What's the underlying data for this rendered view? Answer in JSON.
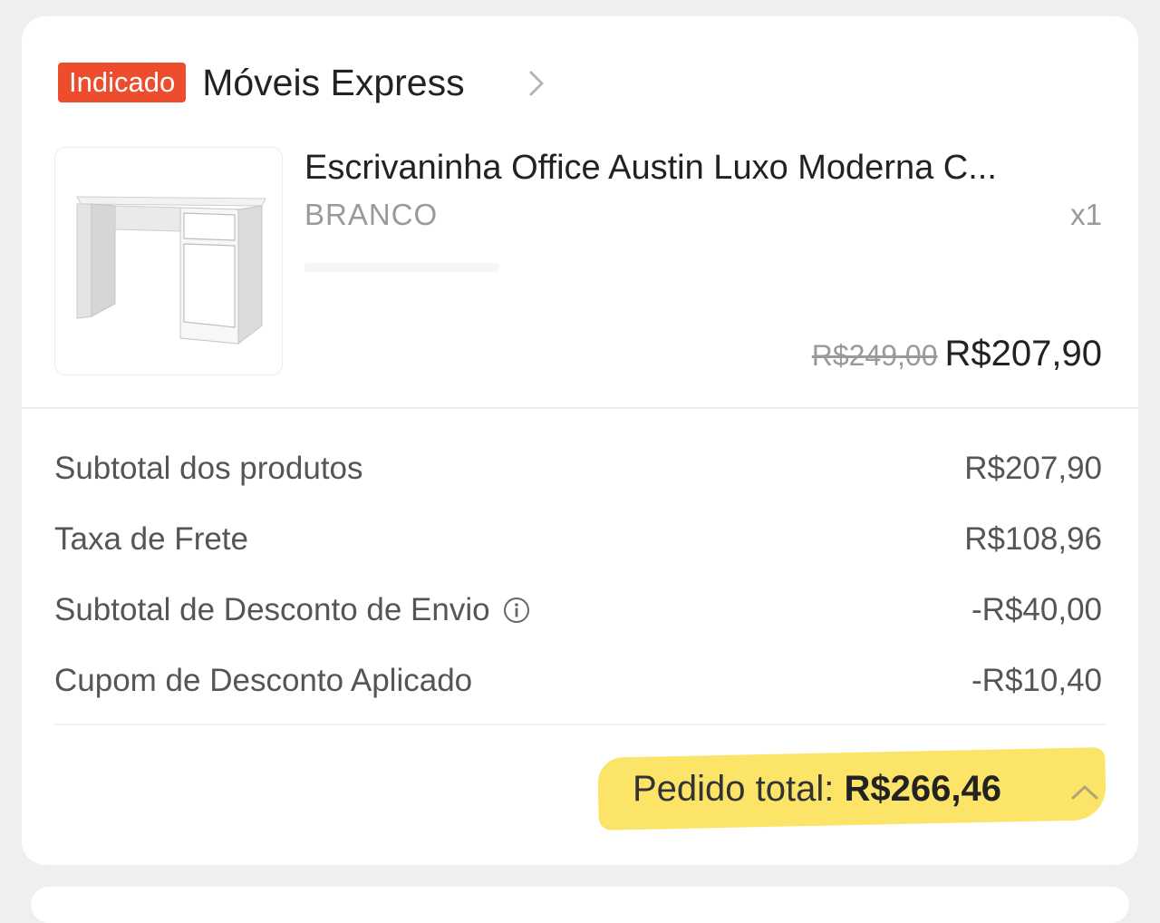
{
  "shop": {
    "badge": "Indicado",
    "name": "Móveis Express"
  },
  "product": {
    "title": "Escrivaninha Office Austin Luxo Moderna C...",
    "variant": "BRANCO",
    "quantity": "x1",
    "original_price": "R$249,00",
    "price": "R$207,90"
  },
  "summary": {
    "rows": [
      {
        "label": "Subtotal dos produtos",
        "value": "R$207,90"
      },
      {
        "label": "Taxa de Frete",
        "value": "R$108,96"
      },
      {
        "label": "Subtotal de Desconto de Envio",
        "value": "-R$40,00"
      },
      {
        "label": "Cupom de Desconto Aplicado",
        "value": "-R$10,40"
      }
    ]
  },
  "total": {
    "label": "Pedido total: ",
    "amount": "R$266,46"
  },
  "colors": {
    "badge": "#ee4d2d",
    "highlight": "#fbe468",
    "page_bg": "#efefef"
  },
  "icons": {
    "shop_link": "chevron-right-icon",
    "info": "info-icon",
    "expand": "chevron-up-icon"
  }
}
